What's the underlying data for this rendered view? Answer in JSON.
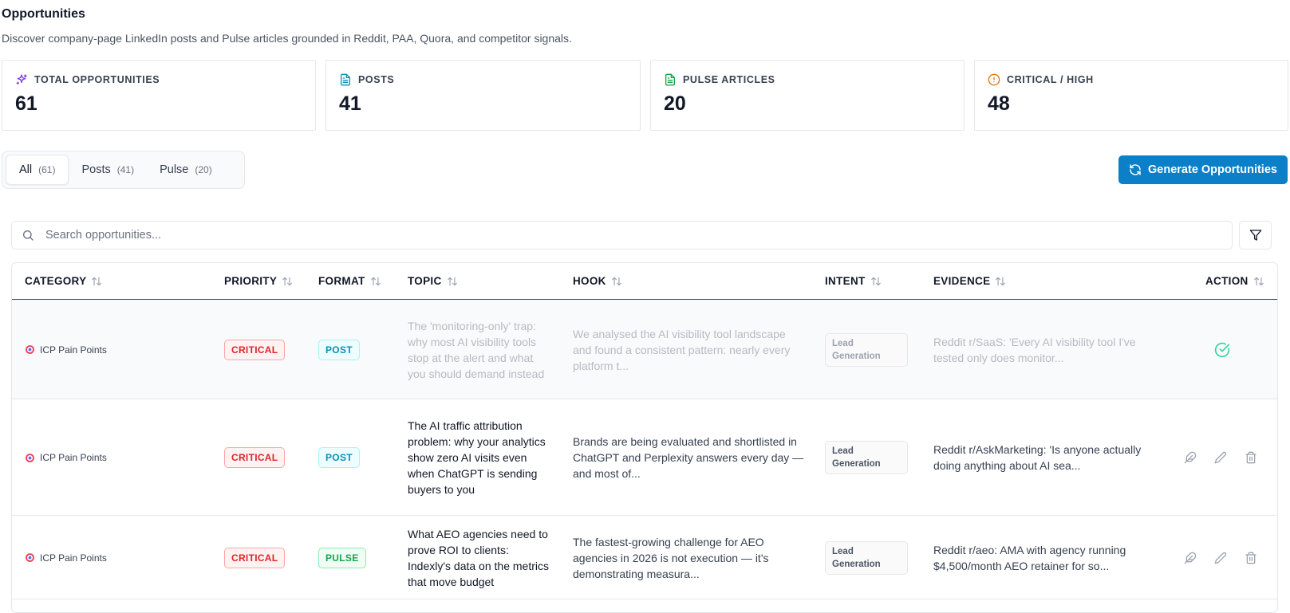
{
  "header": {
    "title": "Opportunities",
    "subtitle": "Discover company-page LinkedIn posts and Pulse articles grounded in Reddit, PAA, Quora, and competitor signals."
  },
  "stats": [
    {
      "label": "TOTAL OPPORTUNITIES",
      "value": "61",
      "icon": "sparkle-icon",
      "color": "#7c3aed"
    },
    {
      "label": "POSTS",
      "value": "41",
      "icon": "document-icon",
      "color": "#0891b2"
    },
    {
      "label": "PULSE ARTICLES",
      "value": "20",
      "icon": "document-icon",
      "color": "#16a34a"
    },
    {
      "label": "CRITICAL / HIGH",
      "value": "48",
      "icon": "alert-circle-icon",
      "color": "#d97706"
    }
  ],
  "tabs": [
    {
      "label": "All",
      "count": "(61)",
      "active": true
    },
    {
      "label": "Posts",
      "count": "(41)",
      "active": false
    },
    {
      "label": "Pulse",
      "count": "(20)",
      "active": false
    }
  ],
  "generate_button": {
    "label": "Generate Opportunities",
    "icon": "refresh-icon",
    "color": "#0b7fc7"
  },
  "search": {
    "placeholder": "Search opportunities..."
  },
  "table": {
    "columns": [
      "CATEGORY",
      "PRIORITY",
      "FORMAT",
      "TOPIC",
      "HOOK",
      "INTENT",
      "EVIDENCE",
      "ACTION"
    ],
    "rows": [
      {
        "category": "ICP Pain Points",
        "priority": "CRITICAL",
        "format": "POST",
        "topic": "The 'monitoring-only' trap: why most AI visibility tools stop at the alert and what you should demand instead",
        "hook": "We analysed the AI visibility tool landscape and found a consistent pattern: nearly every platform t...",
        "intent": "Lead Generation",
        "evidence": "Reddit r/SaaS: 'Every AI visibility tool I've tested only does monitor...",
        "status": "completed"
      },
      {
        "category": "ICP Pain Points",
        "priority": "CRITICAL",
        "format": "POST",
        "topic": "The AI traffic attribution problem: why your analytics show zero AI visits even when ChatGPT is sending buyers to you",
        "hook": "Brands are being evaluated and shortlisted in ChatGPT and Perplexity answers every day — and most of...",
        "intent": "Lead Generation",
        "evidence": "Reddit r/AskMarketing: 'Is anyone actually doing anything about AI sea...",
        "status": "open"
      },
      {
        "category": "ICP Pain Points",
        "priority": "CRITICAL",
        "format": "PULSE",
        "topic": "What AEO agencies need to prove ROI to clients: Indexly's data on the metrics that move budget",
        "hook": "The fastest-growing challenge for AEO agencies in 2026 is not execution — it's demonstrating measura...",
        "intent": "Lead Generation",
        "evidence": "Reddit r/aeo: AMA with agency running $4,500/month AEO retainer for so...",
        "status": "open"
      }
    ]
  }
}
